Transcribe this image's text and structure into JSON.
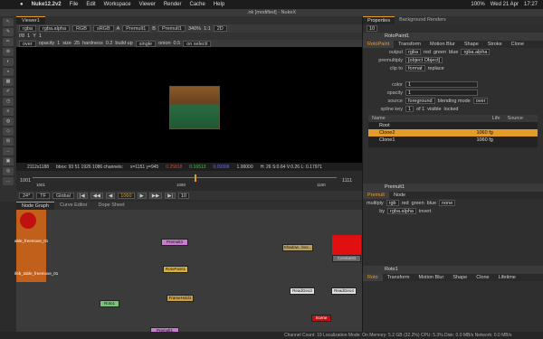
{
  "mac": {
    "apple": "",
    "app": "Nuke12.2v2",
    "menus": [
      "File",
      "Edit",
      "Workspace",
      "Viewer",
      "Render",
      "Cache",
      "Help"
    ],
    "date": "Wed 21 Apr",
    "time": "17:27",
    "battery": "100%"
  },
  "window": {
    "title": ".nk [modified] - NukeX"
  },
  "viewer": {
    "tab": "Viewer1",
    "channels": "rgba",
    "layer": "rgba.alpha",
    "colorspace": "RGB",
    "display": "sRGB",
    "input_a": "A",
    "node_a": "Premult1",
    "input_b": "B",
    "node_b": "Premult1",
    "zoom": "340%",
    "ratio": "1:1",
    "mode": "2D",
    "frame": "f/8",
    "frame_step": "1",
    "y": "Y",
    "gain_val": "1",
    "over": "over",
    "opacity_label": "opacity",
    "opacity": "1",
    "size_label": "size",
    "size": "25",
    "hardness_label": "hardness",
    "hardness": "0.2",
    "build_up": "build up",
    "single": "single",
    "onion_label": "onion",
    "onion": "0.5",
    "on_select": "on selecti",
    "info": {
      "res": "2112x1188",
      "bbox": "bbox: 93 51 1926 1086 channels:",
      "coords": "x=1151 y=945",
      "r": "0.25818",
      "g": "0.16513",
      "b": "0.09306",
      "a": "1.00000",
      "hsvl": "H: 26 S:0.64 V:0.26 L: 0.17971"
    }
  },
  "timeline": {
    "start": "1001",
    "end": "1111",
    "marks": [
      "1001",
      "1050",
      "1100",
      "1111"
    ],
    "fps": "24*",
    "tf": "TF",
    "global": "Global",
    "current": "1060",
    "step": "10"
  },
  "graph": {
    "tabs": [
      "Node Graph",
      "Curve Editor",
      "Dope Sheet"
    ],
    "nodes": [
      {
        "name": "Roto1",
        "sub": "(bezier)"
      },
      {
        "name": "Premult3"
      },
      {
        "name": "RotoPaint1"
      },
      {
        "name": "FrameHold1",
        "sub": "(frame 1060)"
      },
      {
        "name": "Premult1"
      },
      {
        "name": "Constant1"
      },
      {
        "name": "ReadGeo3",
        "sub": "(Cylinder_1.obj)"
      },
      {
        "name": "ReadGeo4",
        "sub": "(Jacket_1.obj)"
      },
      {
        "name": "Shadow...box..."
      },
      {
        "name": "able_freemove_01"
      },
      {
        "name": "ifeb_table_freemove_01"
      },
      {
        "name": "Scene"
      }
    ]
  },
  "status": "Channel Count: 19  Localization Mode: On  Memory: 5.2 GB (32.2%)  CPU: 5.3%  Disk: 0.0 MB/s  Network: 0.0 MB/s",
  "props": {
    "tabs": [
      "Properties",
      "Background Renders"
    ],
    "count": "10",
    "node": "RotoPaint1",
    "subtabs": [
      "RotoPaint",
      "Transform",
      "Motion Blur",
      "Shape",
      "Stroke",
      "Clone"
    ],
    "output_label": "output",
    "output": "rgba",
    "red": "red",
    "green": "green",
    "blue": "blue",
    "alpha": "rgba.alpha",
    "premult_label": "premultiply",
    "premult": {
      "title": "Premult1",
      "tabs": [
        "Premult",
        "Node"
      ],
      "multiply_label": "multiply",
      "multiply": "rgb",
      "red": "red",
      "green": "green",
      "blue": "blue",
      "none": "none",
      "by_label": "by",
      "by": "rgba.alpha",
      "invert": "invert"
    },
    "clip_label": "clip to",
    "clip": "format",
    "replace": "replace",
    "color_label": "color",
    "color": "1",
    "opacity_label": "opacity",
    "opacity": "1",
    "source_label": "source",
    "source": "foreground",
    "blend_label": "blending mode",
    "blend": "over",
    "spline_label": "spline key",
    "spline": "1",
    "of": "of 1",
    "visible": "visible",
    "locked": "locked",
    "tree_head": [
      "Name",
      "Life",
      "Source"
    ],
    "tree": [
      {
        "name": "Root"
      },
      {
        "name": "Clone2",
        "life": "1060",
        "src": "fg"
      },
      {
        "name": "Clone1",
        "life": "1060",
        "src": "fg"
      }
    ],
    "roto": {
      "title": "Roto1",
      "tabs": [
        "Roto",
        "Transform",
        "Motion Blur",
        "Shape",
        "Clone",
        "Lifetime"
      ]
    }
  }
}
